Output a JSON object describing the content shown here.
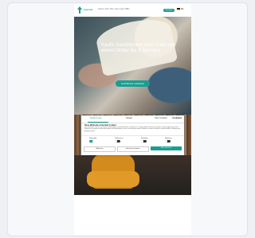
{
  "header": {
    "logo_text": "buecher",
    "search_placeholder": "Suche nach Titel, Autor oder ISBN",
    "cta_label": "Anmelden",
    "language": "DE"
  },
  "hero": {
    "title": "Kaufe Geschichten zum Preis von einem Drittel bis 3 Sternen!",
    "cta_label": "Jetzt Bücher entdecken"
  },
  "cookie": {
    "tabs": [
      "Zustimmung",
      "Details",
      "Über Cookies"
    ],
    "active_tab": 0,
    "brand": "Cookiebot",
    "heading": "Diese Webseite verwendet Cookies",
    "body": "Wir verwenden Cookies, um Inhalte und Anzeigen zu personalisieren, Funktionen für soziale Medien anbieten zu können und die Zugriffe auf unsere Website zu analysieren. Außerdem geben wir Informationen zu Ihrer Verwendung unserer Website an unsere Partner für soziale Medien, Werbung und Analysen weiter.",
    "toggles": [
      {
        "label": "Notwendig",
        "on": true
      },
      {
        "label": "Präferenzen",
        "on": false
      },
      {
        "label": "Statistiken",
        "on": false
      },
      {
        "label": "Marketing",
        "on": false
      }
    ],
    "buttons": {
      "deny": "Ablehnen",
      "allow_selection": "Auswahl erlauben",
      "allow_all": "Alle zulassen"
    },
    "accent": "#1a9e93"
  }
}
